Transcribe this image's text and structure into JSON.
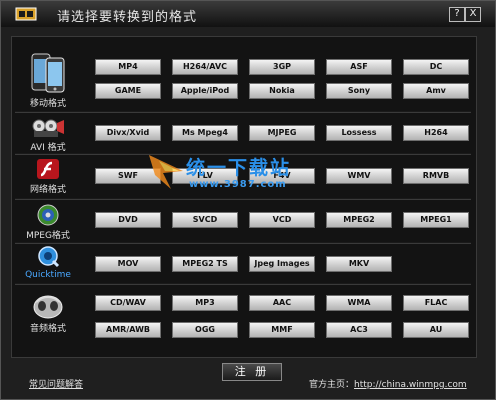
{
  "window": {
    "title": "请选择要转换到的格式",
    "help_label": "?",
    "close_label": "X"
  },
  "categories": [
    {
      "label": "移动格式",
      "icon": "mobile-phone-icon",
      "formats": [
        "MP4",
        "H264/AVC",
        "3GP",
        "ASF",
        "DC",
        "GAME",
        "Apple/iPod",
        "Nokia",
        "Sony",
        "Amv"
      ]
    },
    {
      "label": "AVI 格式",
      "icon": "avi-film-icon",
      "formats": [
        "Divx/Xvid",
        "Ms Mpeg4",
        "MJPEG",
        "Lossess",
        "H264"
      ]
    },
    {
      "label": "网络格式",
      "icon": "flash-icon",
      "formats": [
        "SWF",
        "FLV",
        "F4V",
        "WMV",
        "RMVB"
      ]
    },
    {
      "label": "MPEG格式",
      "icon": "mpeg-disc-icon",
      "formats": [
        "DVD",
        "SVCD",
        "VCD",
        "MPEG2",
        "MPEG1"
      ]
    },
    {
      "label": "Quicktime",
      "icon": "quicktime-icon",
      "formats": [
        "MOV",
        "MPEG2 TS",
        "Jpeg Images",
        "MKV"
      ]
    },
    {
      "label": "音频格式",
      "icon": "audio-headphones-icon",
      "formats": [
        "CD/WAV",
        "MP3",
        "AAC",
        "WMA",
        "FLAC",
        "AMR/AWB",
        "OGG",
        "MMF",
        "AC3",
        "AU"
      ]
    }
  ],
  "footer": {
    "register_label": "注 册",
    "faq_label": "常见问题解答",
    "homepage_prefix": "官方主页：",
    "homepage_url": "http://china.winmpg.com"
  },
  "watermark": {
    "text": "统一下载站",
    "url": "www.3987.com"
  }
}
